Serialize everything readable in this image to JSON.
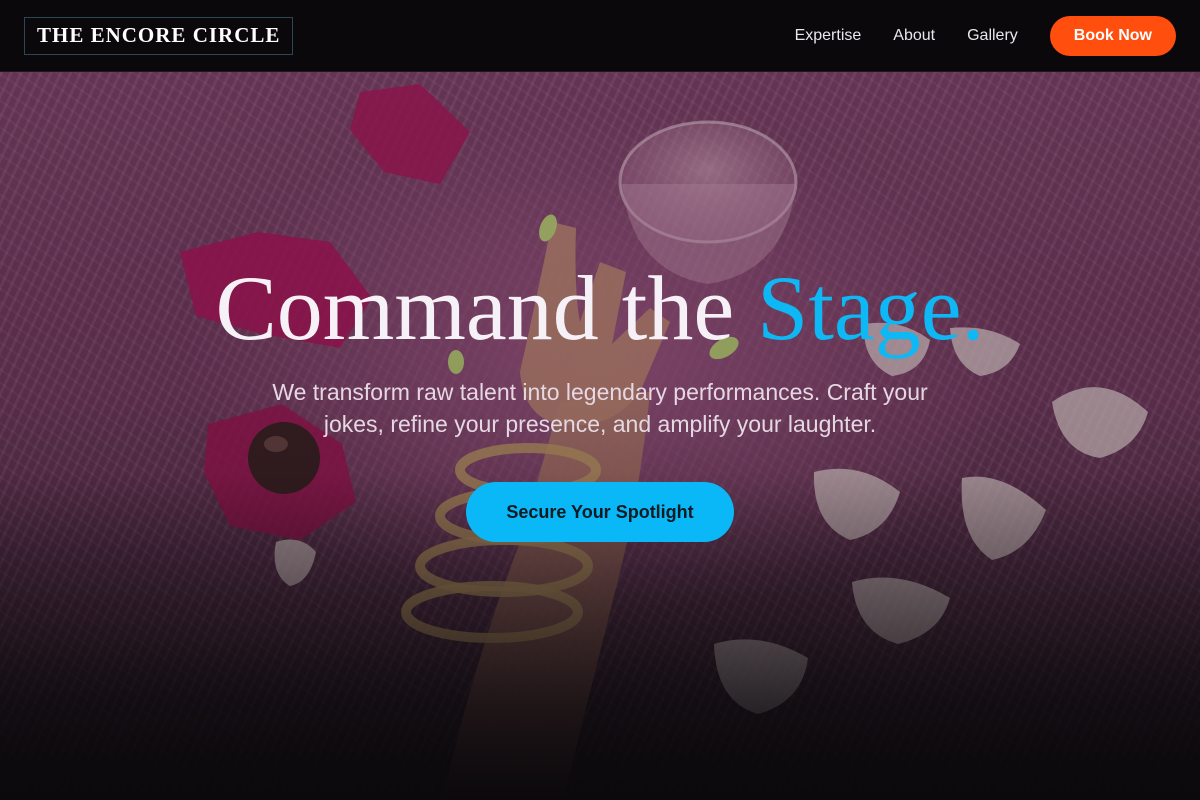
{
  "brand": {
    "name": "THE ENCORE CIRCLE"
  },
  "nav": {
    "links": [
      {
        "label": "Expertise"
      },
      {
        "label": "About"
      },
      {
        "label": "Gallery"
      }
    ],
    "book_label": "Book Now"
  },
  "hero": {
    "headline_main": "Command the ",
    "headline_accent": "Stage.",
    "subtitle": "We transform raw talent into legendary performances. Craft your jokes, refine your presence, and amplify your laughter.",
    "cta_label": "Secure Your Spotlight",
    "background_image": "hand-with-chain-bracelets-rings-champagne-glass-rose-petals-chocolates-on-pink-fur"
  },
  "colors": {
    "nav_bg": "#0a080b",
    "accent_blue": "#0db8f5",
    "book_orange": "#ff4e0e",
    "fur_pink": "#8a4973"
  }
}
